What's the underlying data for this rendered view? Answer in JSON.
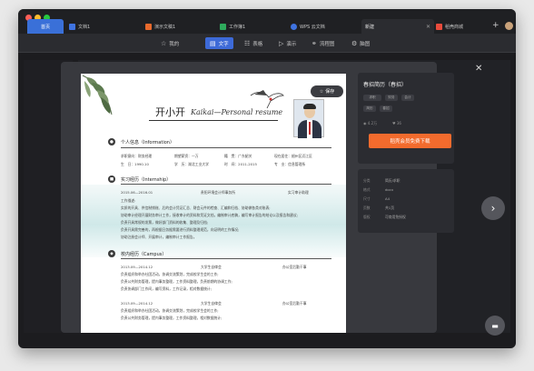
{
  "tabs": [
    {
      "label": "首页"
    },
    {
      "label": "文档1"
    },
    {
      "label": "演示文稿1"
    },
    {
      "label": "工作簿1"
    },
    {
      "label": "WPS 云文档"
    },
    {
      "label": "新建"
    },
    {
      "label": "稻壳商城"
    }
  ],
  "toolbar": {
    "items": [
      {
        "icon": "star-icon",
        "label": "我的"
      },
      {
        "icon": "text-icon",
        "label": "文字"
      },
      {
        "icon": "table-icon",
        "label": "表格"
      },
      {
        "icon": "slides-icon",
        "label": "演示"
      },
      {
        "icon": "flowchart-icon",
        "label": "流程图"
      },
      {
        "icon": "mindmap-icon",
        "label": "脑图"
      }
    ]
  },
  "resume": {
    "save_label": "保存",
    "name": "开小开",
    "name_en": "Kaikai—Personal resume",
    "section_personal": "个人信息（Information）",
    "personal": {
      "r1": [
        "求职意向：财务经理",
        "期望薪资：一万",
        "籍　贯：广东韶关",
        "现在居住：韶州区浈江区"
      ],
      "r2": [
        "生　日：1990.10",
        "学　历：湖北工业大学",
        "时　间：2011-2015",
        "专　业：信息管理系"
      ]
    },
    "section_intern": "实习经历（Internship）",
    "intern": {
      "date": "2015.06—2016.01",
      "company": "贵阳环境会计师事务所",
      "role": "实习审计助理",
      "desc_title": "工作描述:",
      "lines": [
        "实质的开具、供信制销账、后的会计凭证汇总、财会元件的检查、汇编和归档、协助做各类对账表;",
        "协助审计经理开展财务审计工作，接收审计的资料和凭证文档，编制审计底稿，编写审计报告的结论以及报告和建议;",
        "负责开具常规的发票，做好部门资料的收集、整理及归档;",
        "负责开具需完善的，再根据日务据需要进行资料整理规范，向证明的工作情况;",
        "协助注册会计师、开展审计，编制审计工作报告。"
      ]
    },
    "section_campus": "校内经历（Campus）",
    "campus": [
      {
        "date": "2013.09—2014.12",
        "org": "大学生自律会",
        "role": "办公室后勤干事",
        "lines": [
          "负责组织和举办社团活动，协调交流策划，完成校学生会的工作;",
          "负责公共财务管理，提内事务整理，工作资料整理，负责前期的协调工作;",
          "负责协调部门工作间，编写资料，工作记录，相对数据统计;"
        ]
      },
      {
        "date": "2013.09—2014.12",
        "org": "大学生自律会",
        "role": "办公室后勤干事",
        "lines": [
          "负责组织和举办社团活动，协调交流策划，完成校学生会的工作;",
          "负责公共财务管理，提内事务整理，工作资料整理，相对数据统计;"
        ]
      }
    ]
  },
  "sidebar": {
    "title": "春招简历（春招）",
    "chips": [
      "求职",
      "财务",
      "会计",
      "简历",
      "春招"
    ],
    "meta": [
      {
        "icon": "eye-icon",
        "value": "4.2万"
      },
      {
        "icon": "heart-icon",
        "value": "36"
      }
    ],
    "cta_label": "稻壳会员免费下载",
    "info": [
      {
        "k": "分类",
        "v": "简历/求职"
      },
      {
        "k": "格式",
        "v": "docx"
      },
      {
        "k": "尺寸",
        "v": "A4"
      },
      {
        "k": "页数",
        "v": "共1页"
      },
      {
        "k": "版权",
        "v": "可商用免授权"
      }
    ]
  }
}
